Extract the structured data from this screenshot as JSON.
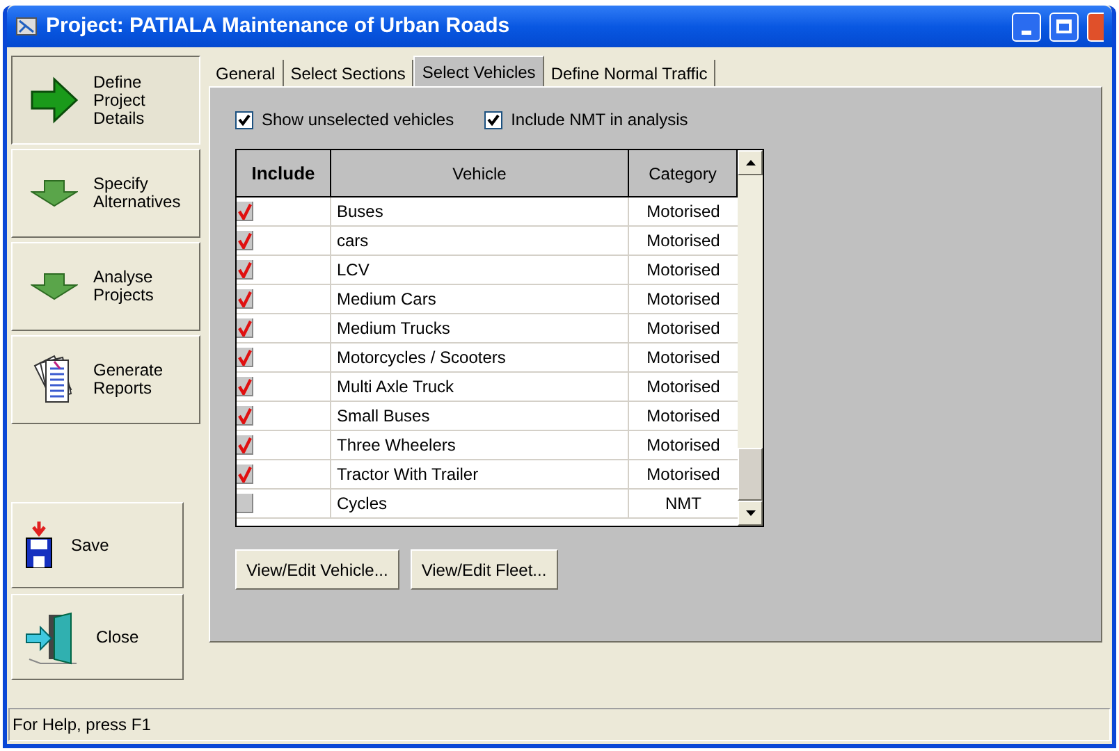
{
  "window": {
    "title": "Project: PATIALA Maintenance of Urban Roads"
  },
  "nav": [
    {
      "kind": "arrow-right",
      "label": "Define Project Details",
      "selected": true
    },
    {
      "kind": "arrow-down",
      "label": "Specify Alternatives",
      "selected": false
    },
    {
      "kind": "arrow-down",
      "label": "Analyse Projects",
      "selected": false
    },
    {
      "kind": "report",
      "label": "Generate Reports",
      "selected": false
    }
  ],
  "actions": [
    {
      "kind": "save",
      "label": "Save"
    },
    {
      "kind": "close",
      "label": "Close"
    }
  ],
  "tabs": [
    {
      "label": "General",
      "selected": false
    },
    {
      "label": "Select Sections",
      "selected": false
    },
    {
      "label": "Select Vehicles",
      "selected": true
    },
    {
      "label": "Define Normal Traffic",
      "selected": false
    }
  ],
  "options": [
    {
      "label": "Show unselected vehicles",
      "checked": true
    },
    {
      "label": "Include NMT in analysis",
      "checked": true
    }
  ],
  "table": {
    "columns": [
      "Include",
      "Vehicle",
      "Category"
    ],
    "rows": [
      {
        "included": true,
        "vehicle": "Buses",
        "category": "Motorised"
      },
      {
        "included": true,
        "vehicle": "cars",
        "category": "Motorised"
      },
      {
        "included": true,
        "vehicle": "LCV",
        "category": "Motorised"
      },
      {
        "included": true,
        "vehicle": "Medium Cars",
        "category": "Motorised"
      },
      {
        "included": true,
        "vehicle": "Medium Trucks",
        "category": "Motorised"
      },
      {
        "included": true,
        "vehicle": "Motorcycles / Scooters",
        "category": "Motorised"
      },
      {
        "included": true,
        "vehicle": "Multi Axle Truck",
        "category": "Motorised"
      },
      {
        "included": true,
        "vehicle": "Small Buses",
        "category": "Motorised"
      },
      {
        "included": true,
        "vehicle": "Three Wheelers",
        "category": "Motorised"
      },
      {
        "included": true,
        "vehicle": "Tractor With Trailer",
        "category": "Motorised"
      },
      {
        "included": false,
        "vehicle": "Cycles",
        "category": "NMT"
      }
    ]
  },
  "buttons": [
    "View/Edit Vehicle...",
    "View/Edit Fleet..."
  ],
  "status_bar": "For Help, press F1"
}
